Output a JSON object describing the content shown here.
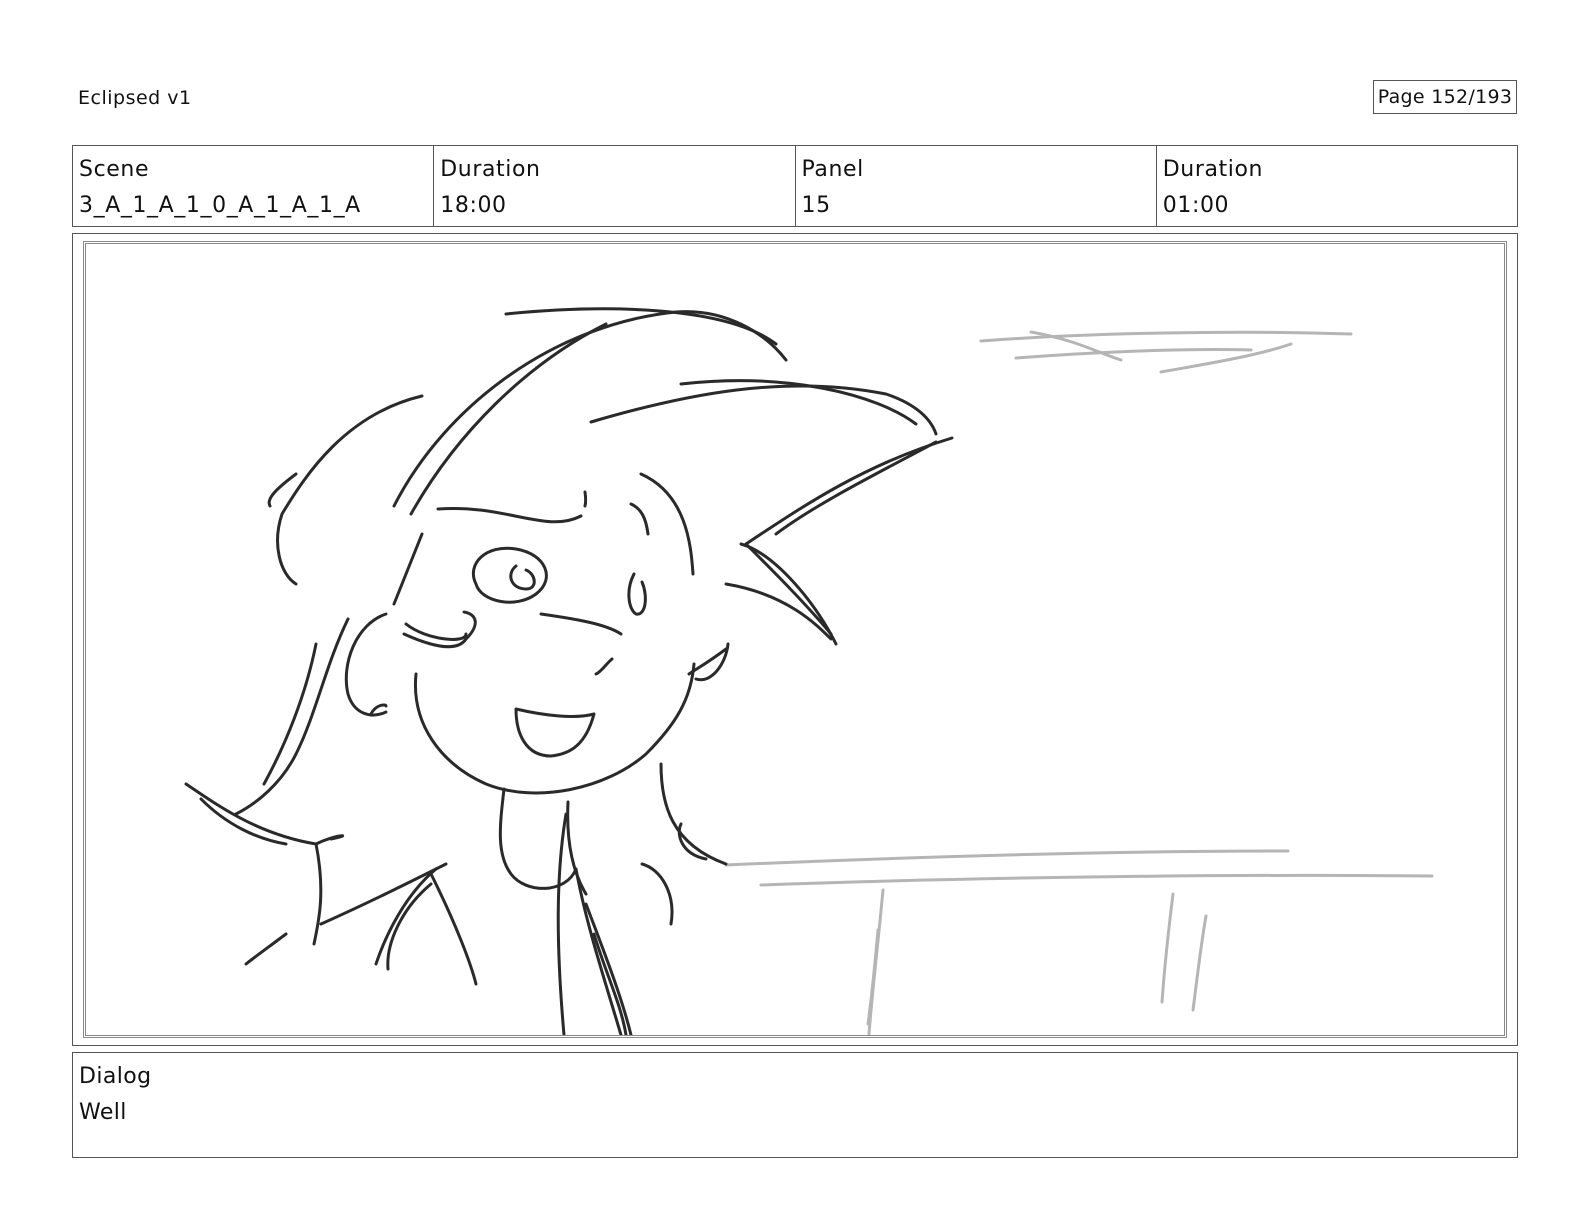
{
  "header": {
    "project_title": "Eclipsed v1",
    "page_label": "Page 152/193"
  },
  "info": {
    "scene_label": "Scene",
    "scene_value": "3_A_1_A_1_0_A_1_A_1_A",
    "scene_duration_label": "Duration",
    "scene_duration_value": "18:00",
    "panel_label": "Panel",
    "panel_value": "15",
    "panel_duration_label": "Duration",
    "panel_duration_value": "01:00"
  },
  "artwork": {
    "description_icon": "storyboard-sketch-image",
    "ink_color": "#2a2a2a",
    "background_line_color": "#b5b5b5"
  },
  "dialog": {
    "label": "Dialog",
    "text": "Well"
  }
}
